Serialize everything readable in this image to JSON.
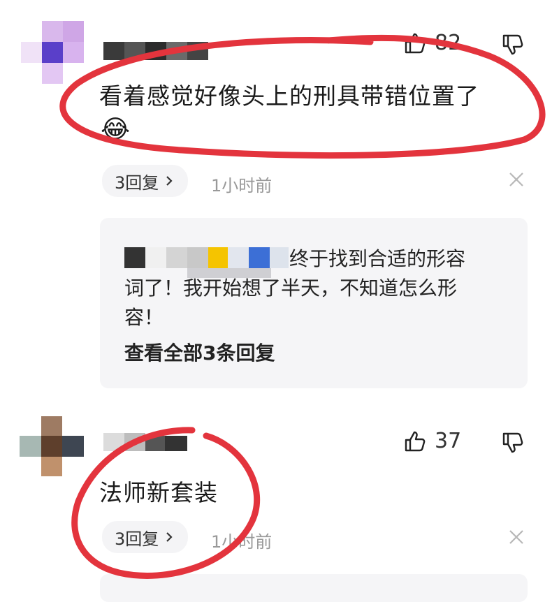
{
  "comments": [
    {
      "likes": "82",
      "text": "看着感觉好像头上的刑具带错位置了",
      "emoji": "😂",
      "reply_count_label": "3回复",
      "time": "1小时前",
      "reply": {
        "text_line1": "终于找到合适的形容",
        "text_line2": "词了！我开始想了半天，不知道怎么形",
        "text_line3": "容！",
        "view_all": "查看全部3条回复"
      }
    },
    {
      "likes": "37",
      "text": "法师新套装",
      "reply_count_label": "3回复",
      "time": "1小时前"
    }
  ],
  "icons": {
    "like": "thumbs-up-icon",
    "dislike": "thumbs-down-icon",
    "chevron": "chevron-right-icon",
    "close": "close-icon"
  },
  "colors": {
    "annotation_red": "#e3343d",
    "reply_bg": "#f5f5f7",
    "muted_text": "#999999"
  }
}
